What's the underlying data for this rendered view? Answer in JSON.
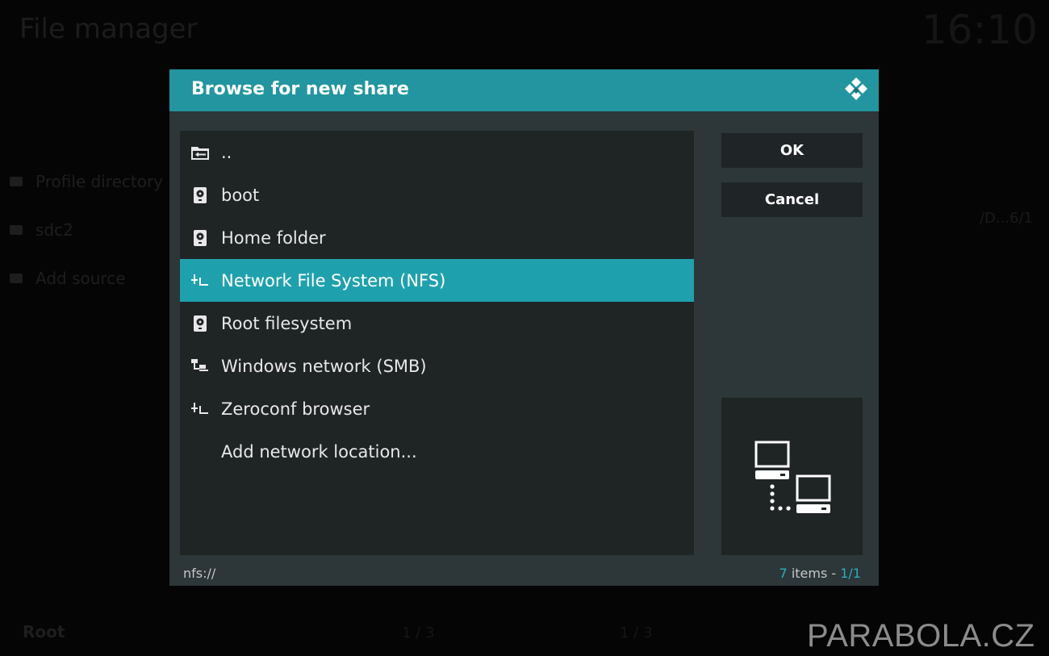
{
  "background": {
    "title": "File manager",
    "clock": "16:10",
    "items": [
      "Profile directory",
      "sdc2",
      "Add source"
    ],
    "right_text": "/D...6/1",
    "root_label": "Root",
    "counter_left": "1 / 3",
    "counter_right": "1 / 3"
  },
  "watermark": "PARABOLA.CZ",
  "dialog": {
    "title": "Browse for new share",
    "items": [
      {
        "label": "..",
        "icon": "folder-back-icon"
      },
      {
        "label": "boot",
        "icon": "hard-drive-icon"
      },
      {
        "label": "Home folder",
        "icon": "hard-drive-icon"
      },
      {
        "label": "Network File System (NFS)",
        "icon": "network-icon",
        "selected": true
      },
      {
        "label": "Root filesystem",
        "icon": "hard-drive-icon"
      },
      {
        "label": "Windows network (SMB)",
        "icon": "network-icon"
      },
      {
        "label": "Zeroconf browser",
        "icon": "network-icon"
      },
      {
        "label": "Add network location...",
        "icon": ""
      }
    ],
    "ok_label": "OK",
    "cancel_label": "Cancel",
    "preview_icon": "network-computers-icon",
    "footer": {
      "path": "nfs://",
      "count_num": "7",
      "count_text": "items -",
      "page": "1/1"
    }
  },
  "colors": {
    "accent": "#1fa1ad",
    "header": "#2295a0"
  }
}
